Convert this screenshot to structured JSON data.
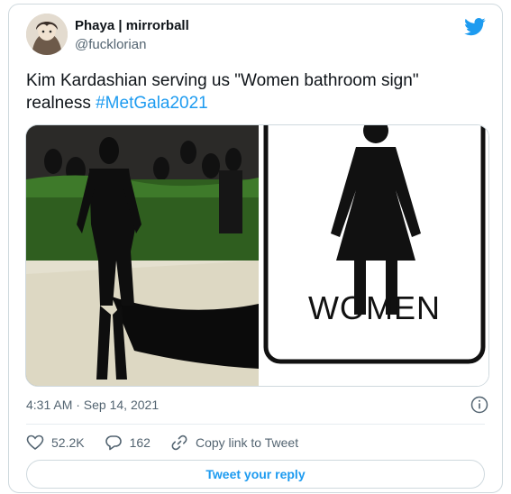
{
  "tweet": {
    "author_name": "Phaya | mirrorball",
    "author_handle": "@fucklorian",
    "text": "Kim Kardashian serving us \"Women bathroom sign\" realness ",
    "hashtag": "#MetGala2021",
    "timestamp": "4:31 AM · Sep 14, 2021"
  },
  "media": {
    "sign_label": "WOMEN"
  },
  "actions": {
    "likes": "52.2K",
    "replies": "162",
    "copy_link": "Copy link to Tweet"
  },
  "reply_button": "Tweet your reply",
  "colors": {
    "accent": "#1d9bf0",
    "text": "#0f1419",
    "muted": "#536471",
    "border": "#cfd9de"
  },
  "icons": [
    "twitter-bird-icon",
    "info-icon",
    "heart-icon",
    "reply-icon",
    "link-icon"
  ]
}
